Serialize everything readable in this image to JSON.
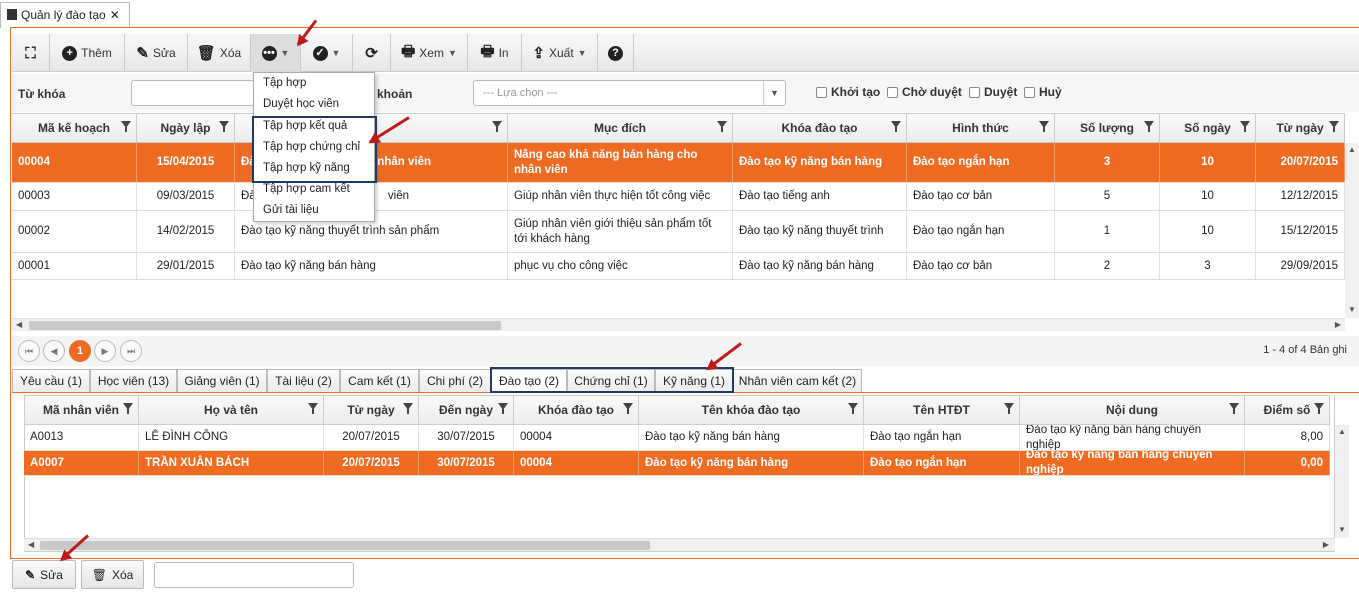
{
  "window": {
    "tab_title": "Quản lý đào tạo"
  },
  "toolbar": {
    "add": "Thêm",
    "edit": "Sửa",
    "delete": "Xóa",
    "view": "Xem",
    "print": "In",
    "export": "Xuất"
  },
  "filter": {
    "keyword_label": "Từ khóa",
    "account_label": "khoản",
    "select_placeholder": "--- Lựa chọn ---",
    "checks": [
      "Khởi tạo",
      "Chờ duyệt",
      "Duyệt",
      "Huỷ"
    ]
  },
  "menu": {
    "items": [
      "Tập hợp",
      "Duyệt học viên",
      "Tập hợp kết quả",
      "Tập hợp chứng chỉ",
      "Tập hợp kỹ năng",
      "Tập hợp cam kết",
      "Gửi tài liệu"
    ]
  },
  "plan_grid": {
    "headers": [
      "Mã kế hoạch",
      "Ngày lập",
      "",
      "Mục đích",
      "Khóa đào tạo",
      "Hình thức",
      "Số lượng",
      "Số ngày",
      "Từ ngày"
    ],
    "rows": [
      {
        "code": "00004",
        "date": "15/04/2015",
        "name": "Đào",
        "name2": "cho nhân viên",
        "purpose": "Nâng cao khả năng bán hàng cho nhân viên",
        "course": "Đào tạo kỹ năng bán hàng",
        "form": "Đào tạo ngắn hạn",
        "qty": "3",
        "days": "10",
        "from": "20/07/2015"
      },
      {
        "code": "00003",
        "date": "09/03/2015",
        "name": "Đà",
        "name2": "viên",
        "purpose": "Giúp nhân viên thực hiện tốt công việc",
        "course": "Đào tạo tiếng anh",
        "form": "Đào tạo cơ bản",
        "qty": "5",
        "days": "10",
        "from": "12/12/2015"
      },
      {
        "code": "00002",
        "date": "14/02/2015",
        "name": "Đào tạo kỹ năng thuyết trình sản phẩm",
        "name2": "",
        "purpose": "Giúp nhân viên giới thiệu sản phẩm tốt tới khách hàng",
        "course": "Đào tạo kỹ năng thuyết trình",
        "form": "Đào tạo ngắn hạn",
        "qty": "1",
        "days": "10",
        "from": "15/12/2015"
      },
      {
        "code": "00001",
        "date": "29/01/2015",
        "name": "Đào tạo kỹ năng bán hàng",
        "name2": "",
        "purpose": "phục vụ cho công việc",
        "course": "Đào tạo kỹ năng bán hàng",
        "form": "Đào tạo cơ bản",
        "qty": "2",
        "days": "3",
        "from": "29/09/2015"
      }
    ]
  },
  "pager": {
    "page": "1",
    "summary": "1 - 4 of 4 Bản ghi"
  },
  "detail_tabs": [
    "Yêu cầu (1)",
    "Học viên (13)",
    "Giảng viên (1)",
    "Tài liệu (2)",
    "Cam kết (1)",
    "Chi phí (2)",
    "Đào tạo (2)",
    "Chứng chỉ (1)",
    "Kỹ năng (1)",
    "Nhân viên cam kết (2)"
  ],
  "detail_grid": {
    "headers": [
      "Mã nhân viên",
      "Họ và tên",
      "Từ ngày",
      "Đến ngày",
      "Khóa đào tạo",
      "Tên khóa đào tạo",
      "Tên HTĐT",
      "Nội dung",
      "Điểm số"
    ],
    "rows": [
      {
        "id": "A0013",
        "name": "LÊ ĐÌNH CÔNG",
        "from": "20/07/2015",
        "to": "30/07/2015",
        "course": "00004",
        "course_name": "Đào tạo kỹ năng bán hàng",
        "form": "Đào tạo ngắn hạn",
        "content": "Đào tạo kỹ năng bán hàng chuyên nghiệp",
        "score": "8,00"
      },
      {
        "id": "A0007",
        "name": "TRẦN XUÂN BÁCH",
        "from": "20/07/2015",
        "to": "30/07/2015",
        "course": "00004",
        "course_name": "Đào tạo kỹ năng bán hàng",
        "form": "Đào tạo ngắn hạn",
        "content": "Đào tạo kỹ năng bán hàng chuyên nghiệp",
        "score": "0,00"
      }
    ]
  },
  "bottom": {
    "edit": "Sửa",
    "delete": "Xóa"
  },
  "colors": {
    "accent": "#ef6b22",
    "highlight_border": "#1f3a66",
    "arrow": "#c01b1b"
  }
}
